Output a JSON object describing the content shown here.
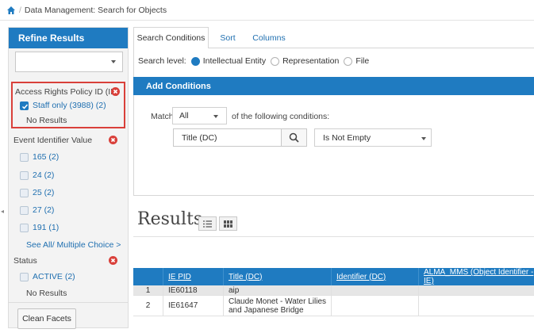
{
  "breadcrumb": {
    "separator": "/",
    "text": "Data Management: Search for Objects"
  },
  "sidebar": {
    "title": "Refine Results",
    "select_value": "",
    "facets": [
      {
        "title": "Access Rights Policy ID (IE)",
        "items": [
          {
            "label": "Staff only (3988) (2)",
            "checked": true
          }
        ],
        "no_results": "No Results"
      },
      {
        "title": "Event Identifier Value",
        "items": [
          {
            "label": "165 (2)"
          },
          {
            "label": "24 (2)"
          },
          {
            "label": "25 (2)"
          },
          {
            "label": "27 (2)"
          },
          {
            "label": "191 (1)"
          }
        ],
        "see_all": "See All/ Multiple Choice >"
      },
      {
        "title": "Status",
        "items": [
          {
            "label": "ACTIVE (2)"
          }
        ],
        "no_results": "No Results"
      }
    ],
    "clean_button": "Clean Facets"
  },
  "tabs": [
    {
      "label": "Search Conditions"
    },
    {
      "label": "Sort"
    },
    {
      "label": "Columns"
    }
  ],
  "search_level": {
    "label": "Search level:",
    "options": [
      {
        "label": "Intellectual Entity",
        "selected": true
      },
      {
        "label": "Representation"
      },
      {
        "label": "File"
      }
    ]
  },
  "conditions": {
    "header": "Add Conditions",
    "match_label": "Match",
    "match_value": "All",
    "match_rest": "of the following conditions:",
    "field": "Title (DC)",
    "operator": "Is Not Empty"
  },
  "results": {
    "title": "Results",
    "columns": [
      "",
      "IE PID",
      "Title (DC)",
      "Identifier (DC)",
      "ALMA_MMS (Object Identifier - IE)"
    ],
    "rows": [
      [
        "1",
        "IE60118",
        "aip",
        "",
        ""
      ],
      [
        "2",
        "IE61647",
        "Claude Monet - Water Lilies and Japanese Bridge",
        "",
        ""
      ]
    ]
  },
  "colors": {
    "primary": "#1f7bc1",
    "danger": "#d9403a",
    "link": "#1f6fb0"
  }
}
